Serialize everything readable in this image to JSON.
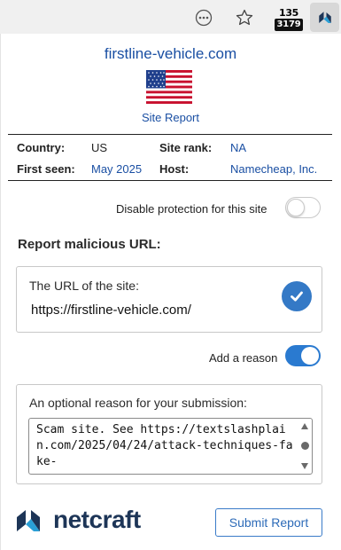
{
  "toolbar": {
    "more_icon": "ellipsis-circle-icon",
    "bookmark_icon": "star-icon",
    "badge_top": "135",
    "badge_bottom": "3179",
    "extension_icon": "netcraft-logo-icon"
  },
  "site": {
    "domain": "firstline-vehicle.com",
    "flag_icon": "us-flag-icon",
    "report_link": "Site Report"
  },
  "info": {
    "country_label": "Country:",
    "country_value": "US",
    "rank_label": "Site rank:",
    "rank_value": "NA",
    "first_seen_label": "First seen:",
    "first_seen_value": "May 2025",
    "host_label": "Host:",
    "host_value": "Namecheap, Inc."
  },
  "protection": {
    "label": "Disable protection for this site",
    "enabled": false
  },
  "report": {
    "title": "Report malicious URL:",
    "url_card_label": "The URL of the site:",
    "url_value": "https://firstline-vehicle.com/",
    "add_reason_label": "Add a reason",
    "add_reason_enabled": true,
    "reason_label": "An optional reason for your submission:",
    "reason_text": "Scam site. See https://textslashplain.com/2025/04/24/attack-techniques-fake-"
  },
  "footer": {
    "logo_text": "netcraft",
    "submit_label": "Submit Report"
  },
  "colors": {
    "link_blue": "#1a4fa3",
    "toggle_blue": "#2a7ad0",
    "brand_navy": "#1d3557",
    "brand_teal": "#2a9fd6"
  }
}
